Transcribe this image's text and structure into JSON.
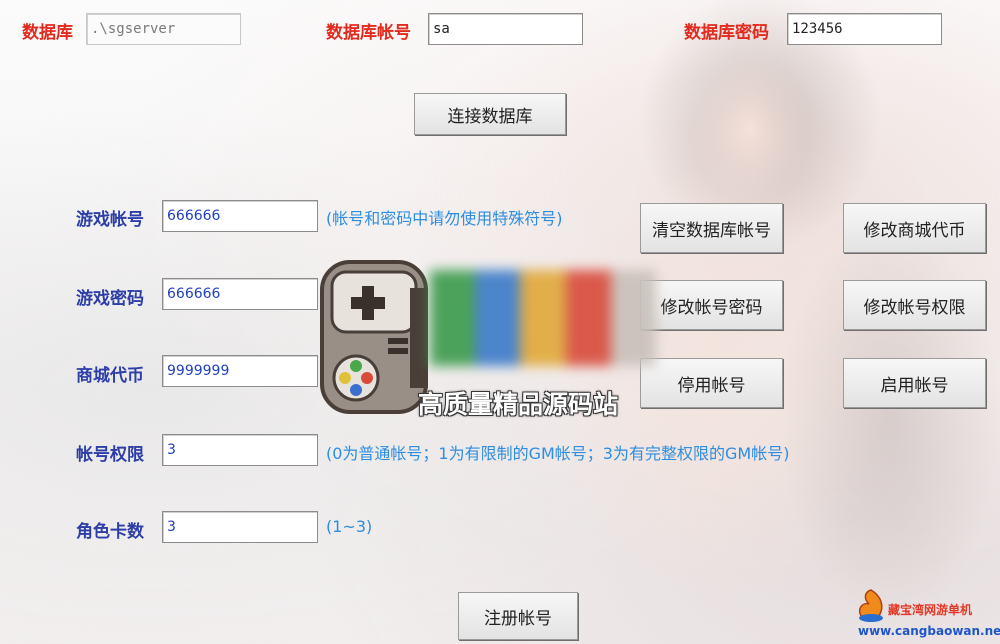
{
  "db": {
    "db_label": "数据库",
    "db_value": ".\\sgserver",
    "account_label": "数据库帐号",
    "account_value": "sa",
    "password_label": "数据库密码",
    "password_value": "123456",
    "connect_button": "连接数据库"
  },
  "game": {
    "account_label": "游戏帐号",
    "account_value": "666666",
    "account_hint": "(帐号和密码中请勿使用特殊符号)",
    "password_label": "游戏密码",
    "password_value": "666666",
    "currency_label": "商城代币",
    "currency_value": "9999999",
    "permission_label": "帐号权限",
    "permission_value": "3",
    "permission_hint": "(0为普通帐号；1为有限制的GM帐号；3为有完整权限的GM帐号)",
    "roles_label": "角色卡数",
    "roles_value": "3",
    "roles_hint": "(1~3)",
    "register_button": "注册帐号"
  },
  "actions": {
    "clear_account": "清空数据库帐号",
    "modify_currency": "修改商城代币",
    "modify_password": "修改帐号密码",
    "modify_permission": "修改帐号权限",
    "disable_account": "停用帐号",
    "enable_account": "启用帐号"
  },
  "watermark": {
    "center_text": "高质量精品源码站",
    "corner_text": "藏宝湾网游单机",
    "corner_url": "www.cangbaowan.net"
  },
  "colors": {
    "label_red": "#e22a1f",
    "label_blue": "#2d3ea8",
    "hint_blue": "#2e8de0"
  }
}
